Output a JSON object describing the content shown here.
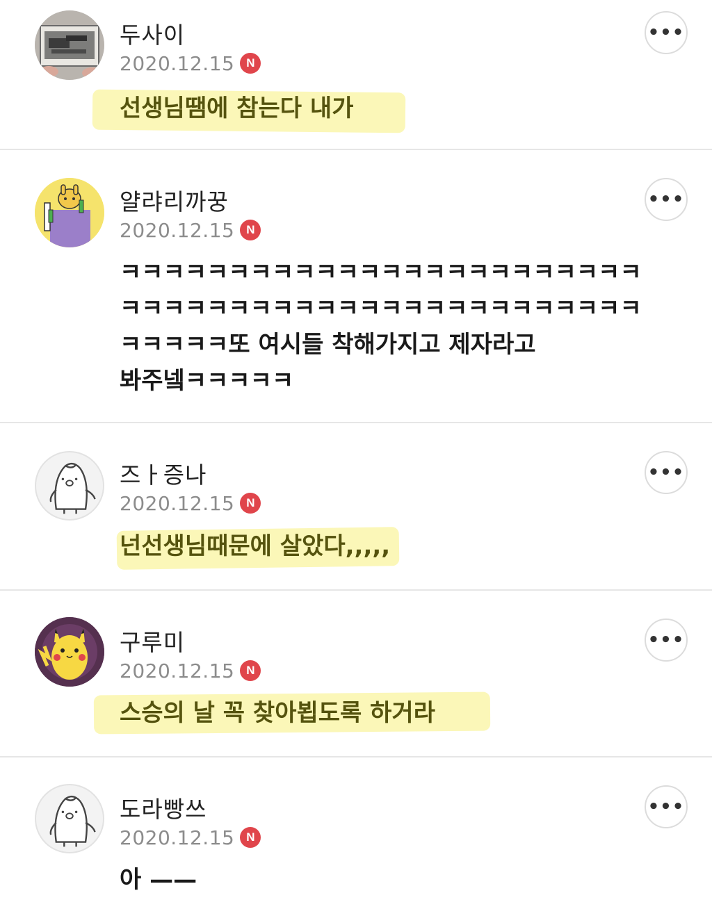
{
  "comments": [
    {
      "nickname": "두사이",
      "date": "2020.12.15",
      "badge": "N",
      "text": "선생님땜에 참는다 내가",
      "highlighted": true,
      "avatar": "photo-avatar"
    },
    {
      "nickname": "얄랴리까꿍",
      "date": "2020.12.15",
      "badge": "N",
      "text_lines": [
        "ㅋㅋㅋㅋㅋㅋㅋㅋㅋㅋㅋㅋㅋㅋㅋㅋㅋㅋㅋㅋㅋㅋㅋㅋ",
        "ㅋㅋㅋㅋㅋㅋㅋㅋㅋㅋㅋㅋㅋㅋㅋㅋㅋㅋㅋㅋㅋㅋㅋㅋ",
        "ㅋㅋㅋㅋㅋ또 여시들 착해가지고 제자라고",
        "봐주넼ㅋㅋㅋㅋㅋ"
      ],
      "highlighted": false,
      "avatar": "cartoon-avatar"
    },
    {
      "nickname": "즈ㅏ증나",
      "date": "2020.12.15",
      "badge": "N",
      "text": "넌선생님때문에 살았다,,,,,",
      "highlighted": true,
      "avatar": "default-penguin-avatar"
    },
    {
      "nickname": "구루미",
      "date": "2020.12.15",
      "badge": "N",
      "text": "스승의 날 꼭 찾아뵙도록 하거라",
      "highlighted": true,
      "avatar": "pikachu-avatar"
    },
    {
      "nickname": "도라빵쓰",
      "date": "2020.12.15",
      "badge": "N",
      "text": "아 ——",
      "highlighted": false,
      "avatar": "default-penguin-avatar"
    }
  ],
  "more_button_label": "•••",
  "colors": {
    "badge": "#e0454b",
    "highlight": "#fbf7b4",
    "divider": "#e6e6e6",
    "date": "#8c8c8c"
  }
}
